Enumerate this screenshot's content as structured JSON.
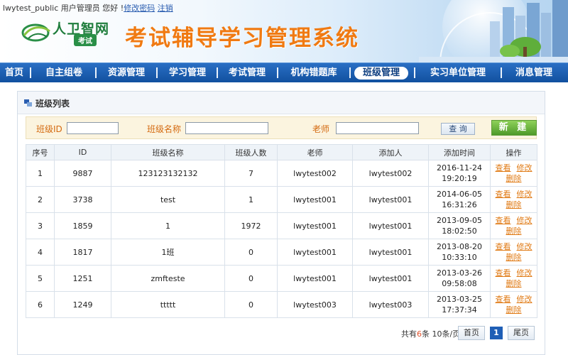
{
  "header": {
    "username": "lwytest_public",
    "role_greeting": "用户管理员 您好 !",
    "change_password": "修改密码",
    "logout": "注销",
    "logo_text": "人卫智网",
    "logo_badge": "考试",
    "system_title": "考试辅导学习管理系统"
  },
  "nav": {
    "items": [
      "首页",
      "自主组卷",
      "资源管理",
      "学习管理",
      "考试管理",
      "机构错题库",
      "班级管理",
      "实习单位管理",
      "消息管理"
    ],
    "active": "班级管理"
  },
  "panel": {
    "title": "班级列表"
  },
  "search": {
    "class_id_label": "班级ID",
    "class_id_value": "",
    "class_name_label": "班级名称",
    "class_name_value": "",
    "teacher_label": "老师",
    "teacher_value": "",
    "search_button": "查 询",
    "new_button": "新 建"
  },
  "table": {
    "headers": [
      "序号",
      "ID",
      "班级名称",
      "班级人数",
      "老师",
      "添加人",
      "添加时间",
      "操作"
    ],
    "rows": [
      {
        "no": "1",
        "id": "9887",
        "name": "123123132132",
        "count": "7",
        "teacher": "lwytest002",
        "creator": "lwytest002",
        "time": "2016-11-24 19:20:19"
      },
      {
        "no": "2",
        "id": "3738",
        "name": "test",
        "count": "1",
        "teacher": "lwytest001",
        "creator": "lwytest001",
        "time": "2014-06-05 16:31:26"
      },
      {
        "no": "3",
        "id": "1859",
        "name": "1",
        "count": "1972",
        "teacher": "lwytest001",
        "creator": "lwytest001",
        "time": "2013-09-05 18:02:50"
      },
      {
        "no": "4",
        "id": "1817",
        "name": "1班",
        "count": "0",
        "teacher": "lwytest001",
        "creator": "lwytest001",
        "time": "2013-08-20 10:33:10"
      },
      {
        "no": "5",
        "id": "1251",
        "name": "zmfteste",
        "count": "0",
        "teacher": "lwytest001",
        "creator": "lwytest001",
        "time": "2013-03-26 09:58:08"
      },
      {
        "no": "6",
        "id": "1249",
        "name": "ttttt",
        "count": "0",
        "teacher": "lwytest003",
        "creator": "lwytest003",
        "time": "2013-03-25 17:37:34"
      }
    ],
    "actions": {
      "view": "查看",
      "edit": "修改",
      "delete": "删除"
    }
  },
  "pager": {
    "total_prefix": "共有",
    "total_count": "6",
    "total_suffix": "条 10条/页",
    "first": "首页",
    "current": "1",
    "last": "尾页"
  },
  "colors": {
    "nav_blue": "#1a5cae",
    "title_orange": "#f07a12",
    "logo_green": "#1f7d3c",
    "link_orange": "#e07a14",
    "new_button_green": "#5aa72f"
  }
}
